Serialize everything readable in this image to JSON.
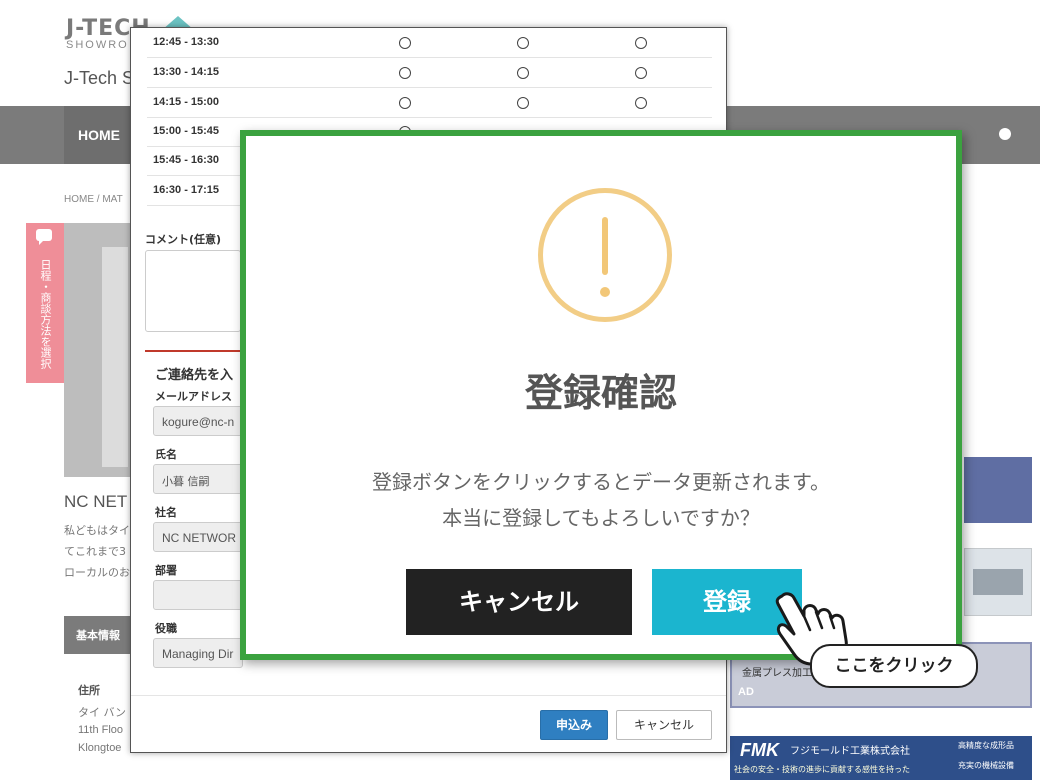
{
  "site": {
    "logo_text": "J-TECH",
    "logo_sub": "SHOWRO",
    "name": "J-Tech S",
    "nav_home": "HOME",
    "breadcrumb": "HOME / MAT",
    "side_tab": "日程・商談方法を選択",
    "company_heading": "NC NET",
    "intro": [
      "私どもはタイ",
      "てこれまで3",
      "ローカルのお"
    ],
    "basic_info": "基本情報",
    "address_label": "住所",
    "address_lines": [
      "タイ バン",
      "11th Floo",
      "Klongtoe"
    ]
  },
  "ads": {
    "press_text1": "金属プレス加工",
    "press_text2": "AD",
    "fmk_logo": "FMK",
    "fmk_name": "フジモールド工業株式会社",
    "fmk_tag": "社会の安全・技術の進歩に貢献する感性を持った",
    "fmk_right1": "高精度な成形品",
    "fmk_right2": "充実の機械設備"
  },
  "booking": {
    "slots": [
      {
        "time": "12:45 - 13:30"
      },
      {
        "time": "13:30 - 14:15"
      },
      {
        "time": "14:15 - 15:00"
      },
      {
        "time": "15:00 - 15:45"
      },
      {
        "time": "15:45 - 16:30"
      },
      {
        "time": "16:30 - 17:15"
      }
    ],
    "comment_label": "コメント(任意)",
    "contact_heading": "ご連絡先を入",
    "fields": {
      "email_label": "メールアドレス",
      "email_value": "kogure@nc-n",
      "name_label": "氏名",
      "name_value": "小暮 信嗣",
      "company_label": "社名",
      "company_value": "NC NETWOR",
      "dept_label": "部署",
      "dept_value": "",
      "title_label": "役職",
      "title_value": "Managing Dir"
    },
    "submit_label": "申込み",
    "cancel_label": "キャンセル"
  },
  "confirm": {
    "title": "登録確認",
    "message_line1": "登録ボタンをクリックするとデータ更新されます。",
    "message_line2": "本当に登録してもよろしいですか？",
    "cancel_label": "キャンセル",
    "register_label": "登録",
    "border_color": "#3ba23f",
    "icon_color": "#f2cd86",
    "register_color": "#1bb5cf"
  },
  "callout": {
    "text": "ここをクリック",
    "icon": "pointing-hand-icon"
  }
}
